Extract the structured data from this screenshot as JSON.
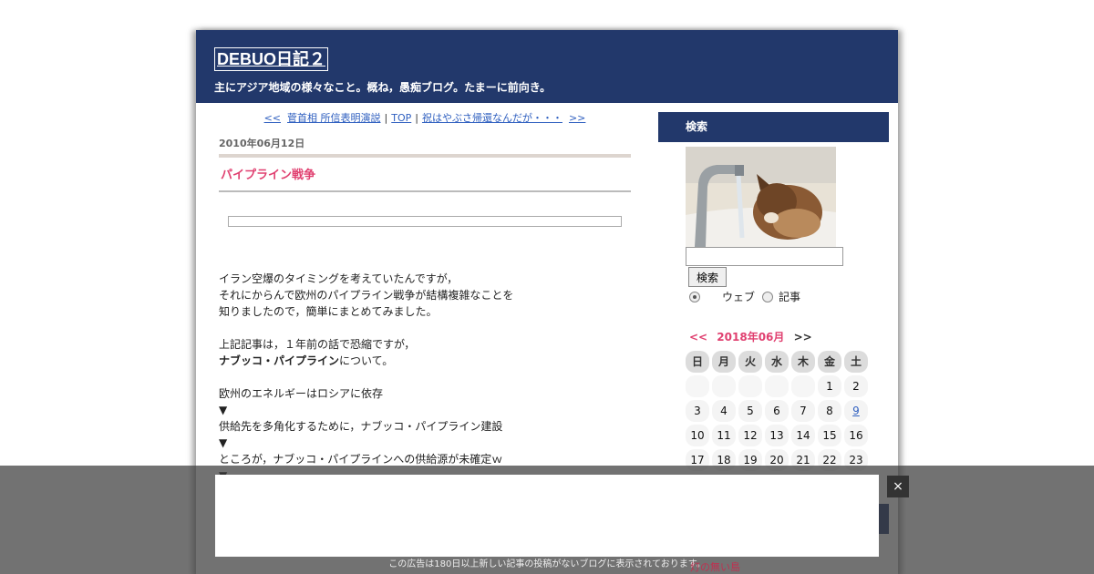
{
  "header": {
    "title": "DEBUO日記２",
    "description": "主にアジア地域の様々なこと。概ね，愚痴ブログ。たまーに前向き。"
  },
  "nav": {
    "prev": "<<",
    "prev_title": "菅首相 所信表明演説",
    "top": "TOP",
    "next_title": "祝はやぶさ帰還なんだが・・・",
    "next": ">>",
    "separator": "|"
  },
  "post": {
    "date": "2010年06月12日",
    "title": "パイプライン戦争",
    "lines": [
      "イラン空爆のタイミングを考えていたんですが，",
      "それにからんで欧州のパイプライン戦争が結構複雑なことを",
      "知りましたので，簡単にまとめてみました。",
      "上記記事は，１年前の話で恐縮ですが，",
      "ナブッコ・パイプライン",
      "について。",
      "欧州のエネルギーはロシアに依存",
      "▼",
      "供給先を多角化するために，ナブッコ・パイプライン建設",
      "▼",
      "ところが，ナブッコ・パイプラインへの供給源が未確定ｗ",
      "▼"
    ]
  },
  "sidebar": {
    "search_heading": "検索",
    "search_value": "",
    "search_button": "検索",
    "radio_web": "ウェブ",
    "radio_article": "記事",
    "calendar": {
      "prev": "<<",
      "month": "2018年06月",
      "next": ">>",
      "weekdays": [
        "日",
        "月",
        "火",
        "水",
        "木",
        "金",
        "土"
      ],
      "rows": [
        [
          "",
          "",
          "",
          "",
          "",
          "1",
          "2"
        ],
        [
          "3",
          "4",
          "5",
          "6",
          "7",
          "8",
          "9"
        ],
        [
          "10",
          "11",
          "12",
          "13",
          "14",
          "15",
          "16"
        ],
        [
          "17",
          "18",
          "19",
          "20",
          "21",
          "22",
          "23"
        ]
      ]
    }
  },
  "overlay": {
    "close": "×",
    "note": "この広告は180日以上新しい記事の投稿がないブログに表示されております。",
    "peek_link": "灯の無い島"
  }
}
